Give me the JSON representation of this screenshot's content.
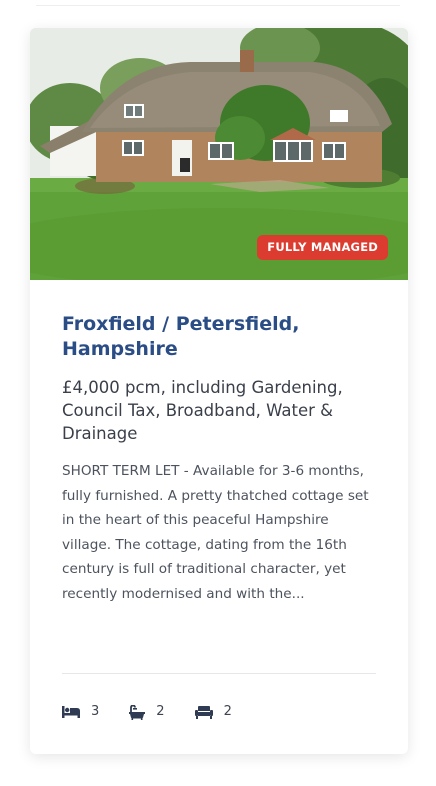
{
  "listing": {
    "badge": "FULLY MANAGED",
    "title": "Froxfield / Petersfield, Hampshire",
    "price": "£4,000 pcm, including Gardening, Council Tax, Broadband, Water & Drainage",
    "description": "SHORT TERM LET - Available for 3-6 months, fully furnished. A pretty thatched cottage set in the heart of this peaceful Hampshire village. The cottage, dating from the 16th century is full of traditional character, yet recently modernised and with the...",
    "features": [
      {
        "icon": "bed-icon",
        "count": "3"
      },
      {
        "icon": "bath-icon",
        "count": "2"
      },
      {
        "icon": "sofa-icon",
        "count": "2"
      }
    ]
  },
  "colors": {
    "title": "#2b4d86",
    "badge": "#dc3c30",
    "icon": "#2f3b52"
  }
}
